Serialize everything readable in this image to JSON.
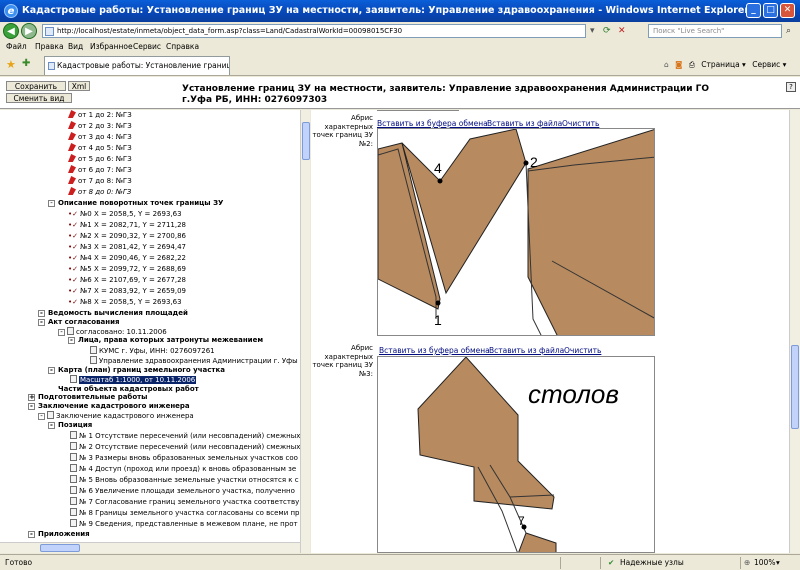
{
  "window": {
    "title": "Кадастровые работы: Установление границ ЗУ на местности, заявитель: Управление здравоохранения  - Windows Internet Explorer"
  },
  "address": {
    "url": "http://localhost/estate/inmeta/object_data_form.asp?class=Land/CadastralWorkId=00098015CF30",
    "search_placeholder": "Поиск \"Live Search\""
  },
  "menu": [
    "Файл",
    "Правка",
    "Вид",
    "Избранное",
    "Сервис",
    "Справка"
  ],
  "tab": {
    "label": "Кадастровые работы: Установление границ ЗУ на..."
  },
  "tab_tools": {
    "page": "Страница",
    "service": "Сервис"
  },
  "app": {
    "save_button": "Сохранить",
    "xml_button": "Xml",
    "view_button": "Сменить вид",
    "title": "Установление границ ЗУ на местности, заявитель: Управление здравоохранения Администрации ГО г.Уфа РБ, ИНН: 0276097303",
    "help": "?"
  },
  "tree": {
    "segments": [
      "от 1 до 2: №ГЗ",
      "от 2 до 3: №ГЗ",
      "от 3 до 4: №ГЗ",
      "от 4 до 5: №ГЗ",
      "от 5 до 6: №ГЗ",
      "от 6 до 7: №ГЗ",
      "от 7 до 8: №ГЗ",
      "от 8 до 0: №ГЗ"
    ],
    "points_header": "Описание поворотных точек границы ЗУ",
    "points": [
      "№0 X = 2058,5, Y = 2693,63",
      "№1 X = 2082,71, Y = 2711,28",
      "№2 X = 2090,32, Y = 2700,86",
      "№3 X = 2081,42, Y = 2694,47",
      "№4 X = 2090,46, Y = 2682,22",
      "№5 X = 2099,72, Y = 2688,69",
      "№6 X = 2107,69, Y = 2677,28",
      "№7 X = 2083,92, Y = 2659,09",
      "№8 X = 2058,5, Y = 2693,63"
    ],
    "area_calc": "Ведомость вычисления площадей",
    "agreement": "Акт согласования",
    "agreed": "согласовано: 10.11.2006",
    "persons": "Лица, права которых затронуты межеванием",
    "person1": "КУМС г. Уфы, ИНН: 0276097261",
    "person2": "Управление здравоохранения Администрации г. Уфы",
    "map_plan": "Карта (план) границ земельного участка",
    "scale": "Масштаб 1:1000, от 10.11.2006",
    "object_parts": "Части объекта кадастровых работ",
    "prep_works": "Подготовительные работы",
    "conclusion": "Заключение кадастрового инженера",
    "conclusion_item": "Заключение кадастрового инженера",
    "position": "Позиция",
    "position_items": [
      "№ 1 Отсутствие пересечений (или несовпадений) смежных",
      "№ 2 Отсутствие пересечений (или несовпадений) смежных",
      "№ 3 Размеры вновь образованных земельных участков соо",
      "№ 4 Доступ (проход или проезд) к вновь образованным зе",
      "№ 5 Вновь образованные земельные участки относятся к с",
      "№ 6 Увеличение площади земельного участка, полученно",
      "№ 7 Согласование границ земельного участка соответству",
      "№ 8 Границы земельного участка согласованы со всеми пр",
      "№ 9 Сведения, представленные в межевом плане, не прот"
    ],
    "appendix": "Приложения"
  },
  "right": {
    "abris_label1": "Абрис характерных точек границ ЗУ №2:",
    "abris_label2": "Абрис характерных точек границ ЗУ №3:",
    "paste_clip": "Вставить из буфера обмена",
    "paste_file": "Вставить из файла",
    "clear": "Очистить",
    "sketch1_labels": [
      "4",
      "2",
      "1"
    ],
    "sketch2_text": "столов",
    "sketch2_point": "7"
  },
  "status": {
    "ready": "Готово",
    "trusted": "Надежные узлы",
    "zoom": "100%"
  },
  "colors": {
    "parcel_fill": "#b78a5f",
    "selection": "#0a246a",
    "link": "#000c80"
  }
}
